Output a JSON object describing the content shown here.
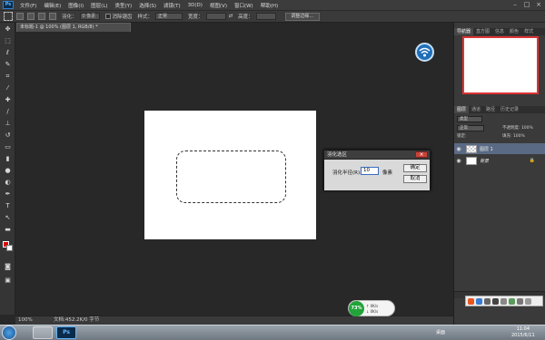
{
  "app": {
    "logo": "Ps",
    "menu": [
      "文件(F)",
      "编辑(E)",
      "图像(I)",
      "图层(L)",
      "类型(Y)",
      "选择(S)",
      "滤镜(T)",
      "3D(D)",
      "视图(V)",
      "窗口(W)",
      "帮助(H)"
    ],
    "window_buttons": [
      "–",
      "□",
      "×"
    ]
  },
  "options": {
    "feather_label": "羽化：",
    "feather_value": "0 像素",
    "antialias_label": "消除锯齿",
    "style_label": "样式：",
    "style_value": "正常",
    "width_label": "宽度：",
    "height_label": "高度：",
    "refine_edge_label": "调整边缘..."
  },
  "document": {
    "tab_label": "未标题-1 @ 100% (图层 1, RGB/8) *"
  },
  "dialog": {
    "title": "羽化选区",
    "close": "×",
    "radius_label": "羽化半径(R):",
    "radius_value": "10",
    "unit": "像素",
    "ok_label": "确定",
    "cancel_label": "取消"
  },
  "status": {
    "zoom": "100%",
    "doc_info": "文档:452.2K/0 字节"
  },
  "speed_widget": {
    "percent": "73%",
    "up": "0K/s",
    "down": "0K/s"
  },
  "panels": {
    "top_tabs": [
      "导航器",
      "直方图",
      "信息",
      "颜色",
      "样式"
    ],
    "layer_tabs": [
      "图层",
      "通道",
      "路径",
      "历史记录"
    ],
    "kind_label": "类型",
    "blend_mode": "正常",
    "opacity_label": "不透明度: 100%",
    "lock_label": "锁定:",
    "fill_label": "填充: 100%",
    "layers": [
      {
        "name": "图层 1",
        "selected": true
      },
      {
        "name": "背景",
        "selected": false
      }
    ]
  },
  "taskbar": {
    "ps_label": "Ps",
    "desktop_label": "桌面",
    "time": "11:04",
    "date": "2015/6/11"
  },
  "colors": {
    "foreground": "#e00000",
    "background": "#ffffff",
    "navigator_frame": "#dd3333"
  }
}
